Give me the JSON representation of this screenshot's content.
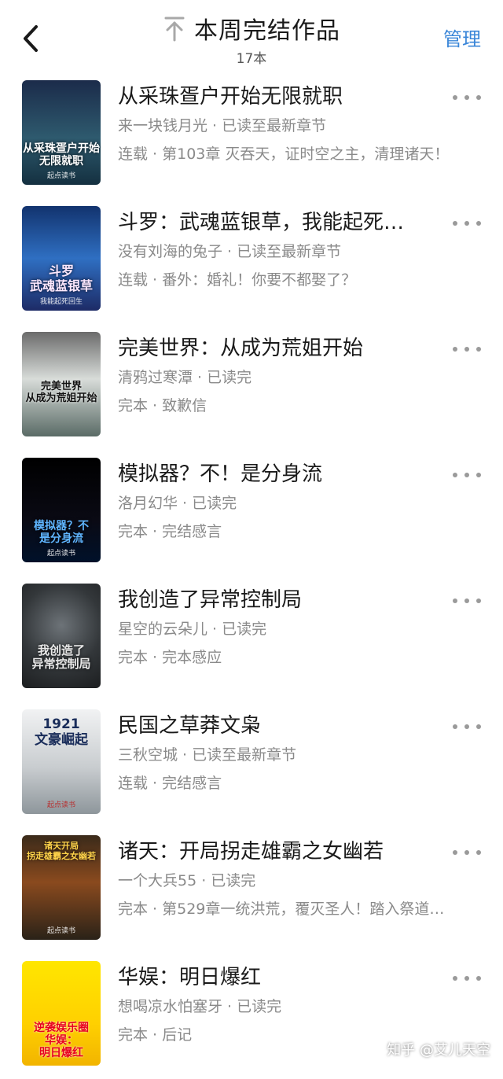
{
  "header": {
    "title": "本周完结作品",
    "subtitle": "17本",
    "manage_label": "管理"
  },
  "books": [
    {
      "title": "从采珠疍户开始无限就职",
      "meta": "来一块钱月光 · 已读至最新章节",
      "status": "连载 · 第103章 灭吞天，证时空之主，清理诸天！",
      "cover_text": "从采珠疍户开始\n无限就职",
      "cover_badge": "起点读书"
    },
    {
      "title": "斗罗：武魂蓝银草，我能起死…",
      "meta": "没有刘海的兔子 · 已读至最新章节",
      "status": "连载 · 番外：婚礼！你要不都娶了？",
      "cover_text": "斗罗\n武魂蓝银草",
      "cover_badge": "我能起死回生"
    },
    {
      "title": "完美世界：从成为荒姐开始",
      "meta": "清鸦过寒潭 · 已读完",
      "status": "完本 · 致歉信",
      "cover_text": "完美世界\n从成为荒姐开始",
      "cover_badge": ""
    },
    {
      "title": "模拟器？不！是分身流",
      "meta": "洛月幻华 · 已读完",
      "status": "完本 · 完结感言",
      "cover_text": "模拟器？不\n是分身流",
      "cover_badge": "起点读书"
    },
    {
      "title": "我创造了异常控制局",
      "meta": "星空的云朵儿 · 已读完",
      "status": "完本 · 完本感应",
      "cover_text": "我创造了\n异常控制局",
      "cover_badge": ""
    },
    {
      "title": "民国之草莽文枭",
      "meta": "三秋空城 · 已读至最新章节",
      "status": "连载 · 完结感言",
      "cover_text": "1921\n文豪崛起",
      "cover_badge": "起点读书"
    },
    {
      "title": "诸天：开局拐走雄霸之女幽若",
      "meta": "一个大兵55 · 已读完",
      "status": "完本 · 第529章一统洪荒，覆灭圣人！踏入祭道…",
      "cover_text": "诸天开局\n拐走雄霸之女幽若",
      "cover_badge": "起点读书"
    },
    {
      "title": "华娱：明日爆红",
      "meta": "想喝凉水怕塞牙 · 已读完",
      "status": "完本 · 后记",
      "cover_text": "逆袭娱乐圈\n华娱：\n明日爆红",
      "cover_badge": ""
    }
  ],
  "watermark": "知乎 @艾儿天空"
}
